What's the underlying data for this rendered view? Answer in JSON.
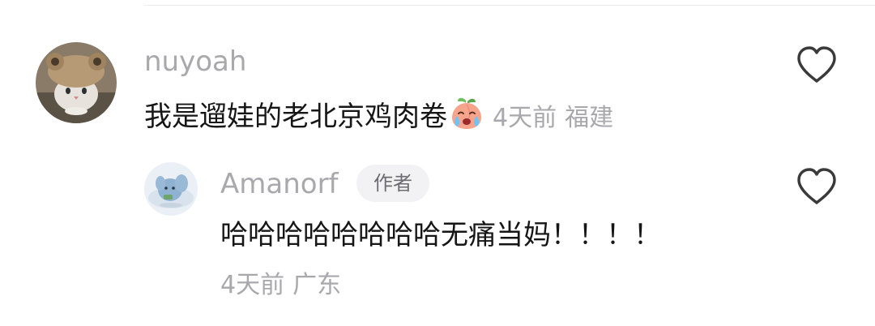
{
  "comments": [
    {
      "username": "nuyoah",
      "text": "我是遛娃的老北京鸡肉卷",
      "emoji_icon": "crying-peach-emoji",
      "time": "4天前",
      "location": "福建",
      "avatar_icon": "cat-with-bear-hat-avatar"
    }
  ],
  "reply": {
    "username": "Amanorf",
    "badge": "作者",
    "text": "哈哈哈哈哈哈哈哈无痛当妈！！！！",
    "time": "4天前",
    "location": "广东",
    "avatar_icon": "blue-plush-doll-avatar"
  },
  "icons": {
    "like": "heart-outline-icon"
  },
  "colors": {
    "text_primary": "#161616",
    "text_muted": "#a8a8ad",
    "badge_bg": "#f2f2f4",
    "badge_text": "#6c6c72",
    "icon_stroke": "#3a3a3a"
  }
}
